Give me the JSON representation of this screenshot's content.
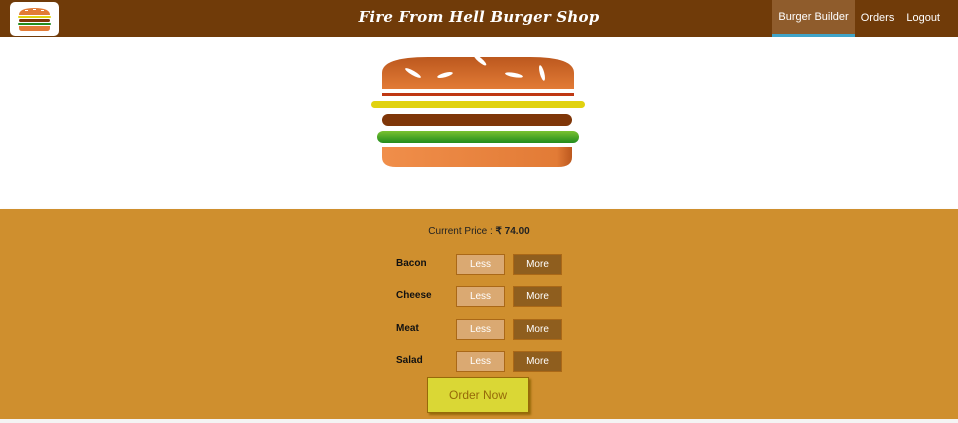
{
  "header": {
    "title": "Fire From Hell Burger Shop",
    "nav": [
      {
        "label": "Burger Builder",
        "active": true
      },
      {
        "label": "Orders",
        "active": false
      },
      {
        "label": "Logout",
        "active": false
      }
    ],
    "logo_icon": "burger-logo-icon"
  },
  "burger": {
    "layers": [
      "bread-top",
      "bacon",
      "cheese",
      "meat",
      "salad",
      "bread-bottom"
    ],
    "colors": {
      "bread": "#E27B36",
      "cheese": "#E1D20F",
      "meat": "#7F3608",
      "salad": "#228C1D",
      "bacon": "#BF3813"
    }
  },
  "controls": {
    "price_label": "Current Price :",
    "price_value": "₹ 74.00",
    "ingredients": [
      {
        "label": "Bacon",
        "less": "Less",
        "more": "More"
      },
      {
        "label": "Cheese",
        "less": "Less",
        "more": "More"
      },
      {
        "label": "Meat",
        "less": "Less",
        "more": "More"
      },
      {
        "label": "Salad",
        "less": "Less",
        "more": "More"
      }
    ],
    "order_button": "Order Now"
  },
  "colors": {
    "toolbar": "#703B09",
    "controls_bg": "#CF8F2E",
    "active_nav": "#8F5C2C",
    "order_button": "#DAD735"
  }
}
